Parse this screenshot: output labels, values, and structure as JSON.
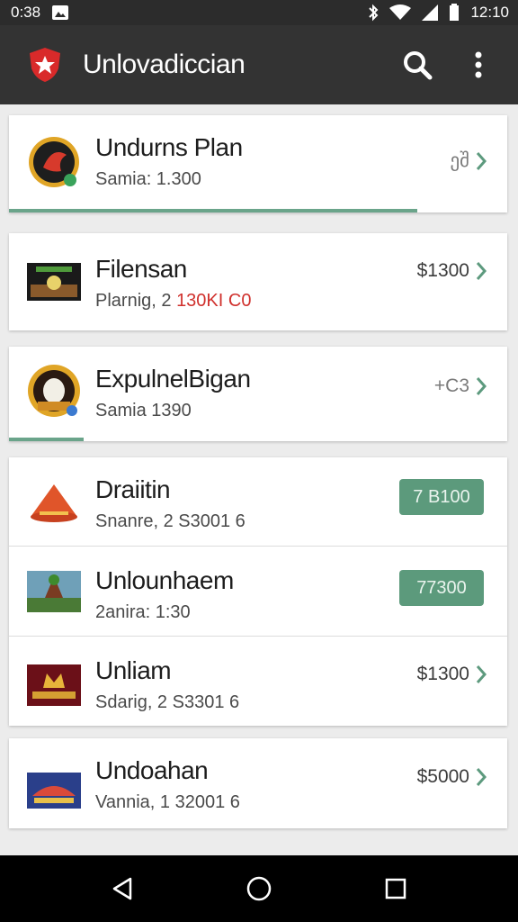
{
  "status_bar": {
    "time_left": "0:38",
    "time_right": "12:10"
  },
  "app_bar": {
    "title": "Unlovadiccian"
  },
  "items": [
    {
      "title": "Undurns Plan",
      "subtitle": "Samia: 1.300",
      "price": "ეშ",
      "progress": 0.82
    },
    {
      "title": "Filensan",
      "subtitle_main": "Plarnig, 2 ",
      "subtitle_highlight": "130KI C0",
      "price": "$1300"
    },
    {
      "title": "ExpulnelBigan",
      "subtitle": "Samia 1390",
      "price": "+C3",
      "progress": 0.15
    },
    {
      "title": "Draiitin",
      "subtitle": "Snanre, 2 S3001 6",
      "pill": "7 B100"
    },
    {
      "title": "Unlounhaem",
      "subtitle": "2anira: 1:30",
      "pill": "77300"
    },
    {
      "title": "Unliam",
      "subtitle": "Sdarig, 2 S3301 6",
      "price": "$1300"
    },
    {
      "title": "Undoahan",
      "subtitle": "Vannia, 1 32001 6",
      "price": "$5000"
    }
  ],
  "colors": {
    "appbar": "#333333",
    "accent_green": "#5c9a7c",
    "highlight_red": "#d0312d"
  },
  "icons": [
    "shield-star-icon",
    "search-icon",
    "more-vert-icon",
    "chevron-right-icon",
    "back-icon",
    "home-icon",
    "recents-icon"
  ]
}
